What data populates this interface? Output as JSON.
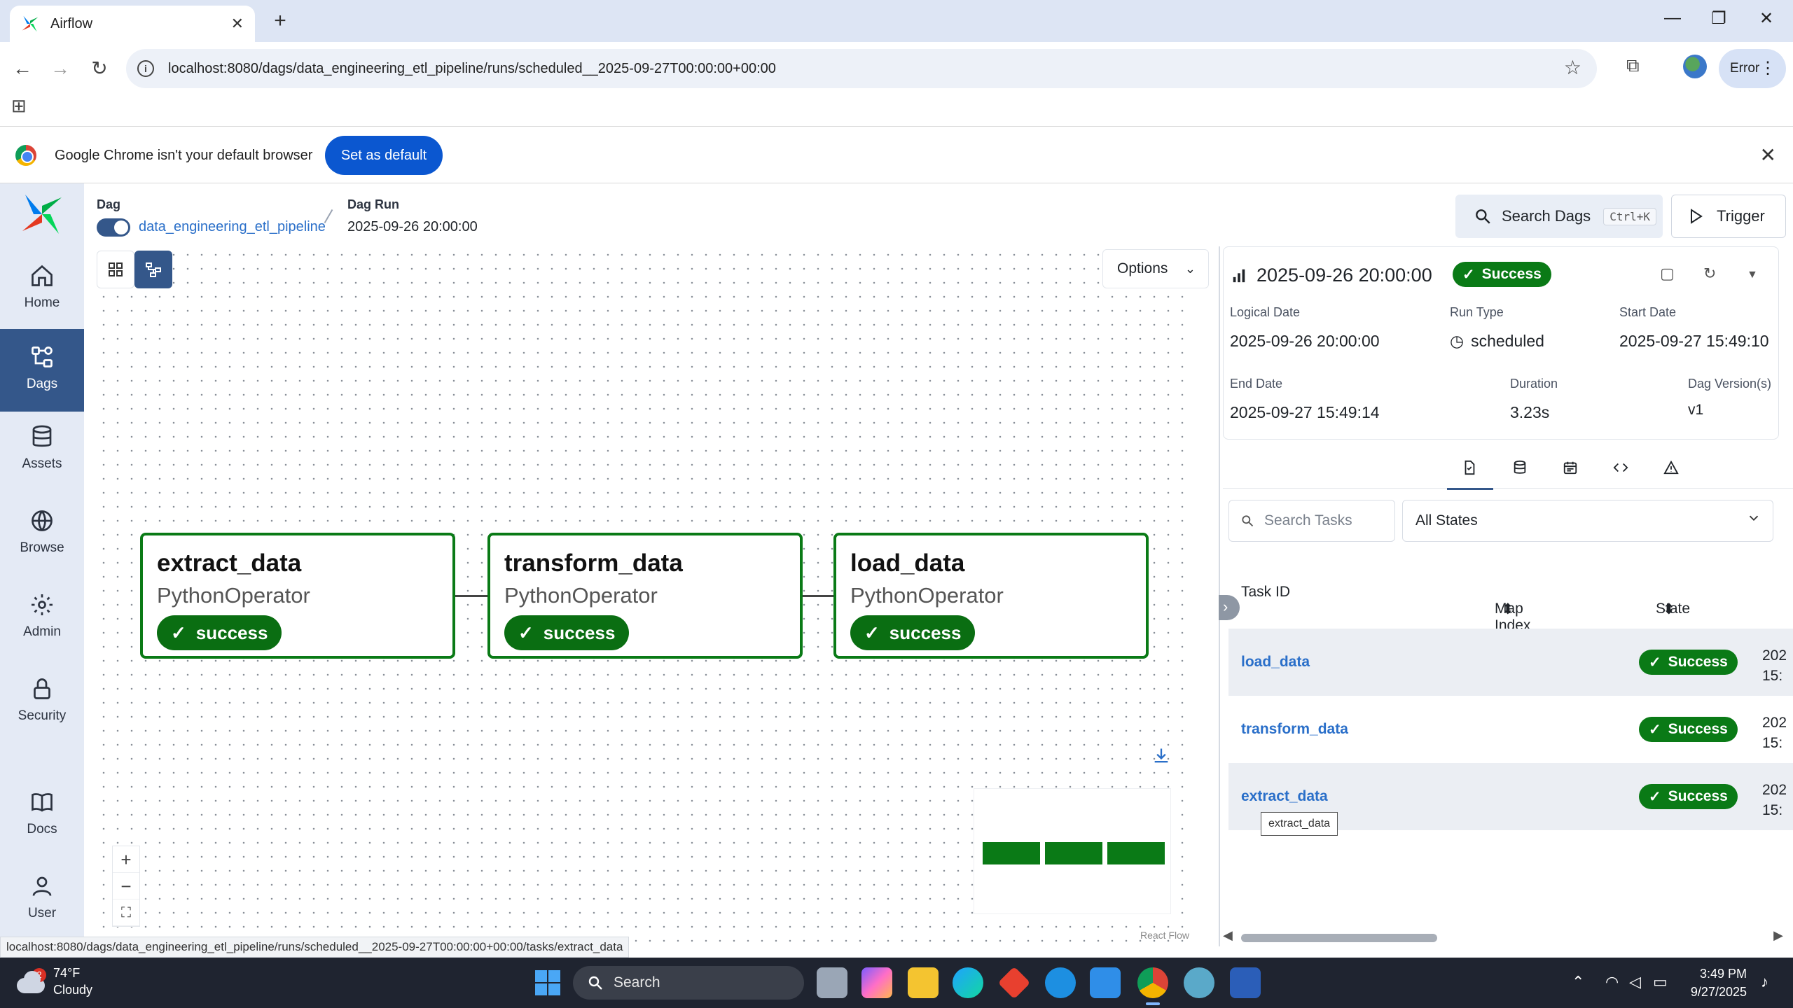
{
  "browser": {
    "tab_title": "Airflow",
    "url": "localhost:8080/dags/data_engineering_etl_pipeline/runs/scheduled__2025-09-27T00:00:00+00:00",
    "profile_label": "Error",
    "infobar_message": "Google Chrome isn't your default browser",
    "infobar_button": "Set as default",
    "status_url": "localhost:8080/dags/data_engineering_etl_pipeline/runs/scheduled__2025-09-27T00:00:00+00:00/tasks/extract_data"
  },
  "nav": {
    "items": [
      {
        "label": "Home",
        "icon": "home-icon"
      },
      {
        "label": "Dags",
        "icon": "dags-icon"
      },
      {
        "label": "Assets",
        "icon": "database-icon"
      },
      {
        "label": "Browse",
        "icon": "globe-icon"
      },
      {
        "label": "Admin",
        "icon": "gear-icon"
      },
      {
        "label": "Security",
        "icon": "lock-icon"
      },
      {
        "label": "Docs",
        "icon": "book-icon"
      },
      {
        "label": "User",
        "icon": "user-icon"
      }
    ],
    "active": "Dags"
  },
  "header": {
    "dag_label": "Dag",
    "dag_id": "data_engineering_etl_pipeline",
    "run_label": "Dag Run",
    "run_value": "2025-09-26 20:00:00",
    "search_label": "Search Dags",
    "search_shortcut": "Ctrl+K",
    "trigger_label": "Trigger"
  },
  "graph": {
    "options_label": "Options",
    "attribution": "React Flow",
    "tasks": [
      {
        "name": "extract_data",
        "operator": "PythonOperator",
        "state": "success"
      },
      {
        "name": "transform_data",
        "operator": "PythonOperator",
        "state": "success"
      },
      {
        "name": "load_data",
        "operator": "PythonOperator",
        "state": "success"
      }
    ]
  },
  "details": {
    "run_title": "2025-09-26 20:00:00",
    "status": "Success",
    "fields": {
      "logical_date_label": "Logical Date",
      "logical_date": "2025-09-26 20:00:00",
      "run_type_label": "Run Type",
      "run_type": "scheduled",
      "start_date_label": "Start Date",
      "start_date": "2025-09-27 15:49:10",
      "end_date_label": "End Date",
      "end_date": "2025-09-27 15:49:14",
      "duration_label": "Duration",
      "duration": "3.23s",
      "dag_version_label": "Dag Version(s)",
      "dag_version": "v1"
    },
    "search_placeholder": "Search Tasks",
    "states_filter": "All States",
    "columns": {
      "task_id": "Task ID",
      "map_index": "Map Index",
      "state": "State"
    },
    "rows": [
      {
        "task_id": "load_data",
        "state": "Success",
        "date_l1": "202",
        "date_l2": "15:"
      },
      {
        "task_id": "transform_data",
        "state": "Success",
        "date_l1": "202",
        "date_l2": "15:"
      },
      {
        "task_id": "extract_data",
        "state": "Success",
        "date_l1": "202",
        "date_l2": "15:"
      }
    ],
    "tooltip": "extract_data"
  },
  "taskbar": {
    "weather_temp": "74°F",
    "weather_desc": "Cloudy",
    "weather_badge": "2",
    "search_label": "Search",
    "time": "3:49 PM",
    "date": "9/27/2025"
  },
  "colors": {
    "airflow_nav_active": "#34578a",
    "success_green": "#0a7a16",
    "link_blue": "#2a6fc9",
    "chrome_button": "#0b57d0"
  }
}
